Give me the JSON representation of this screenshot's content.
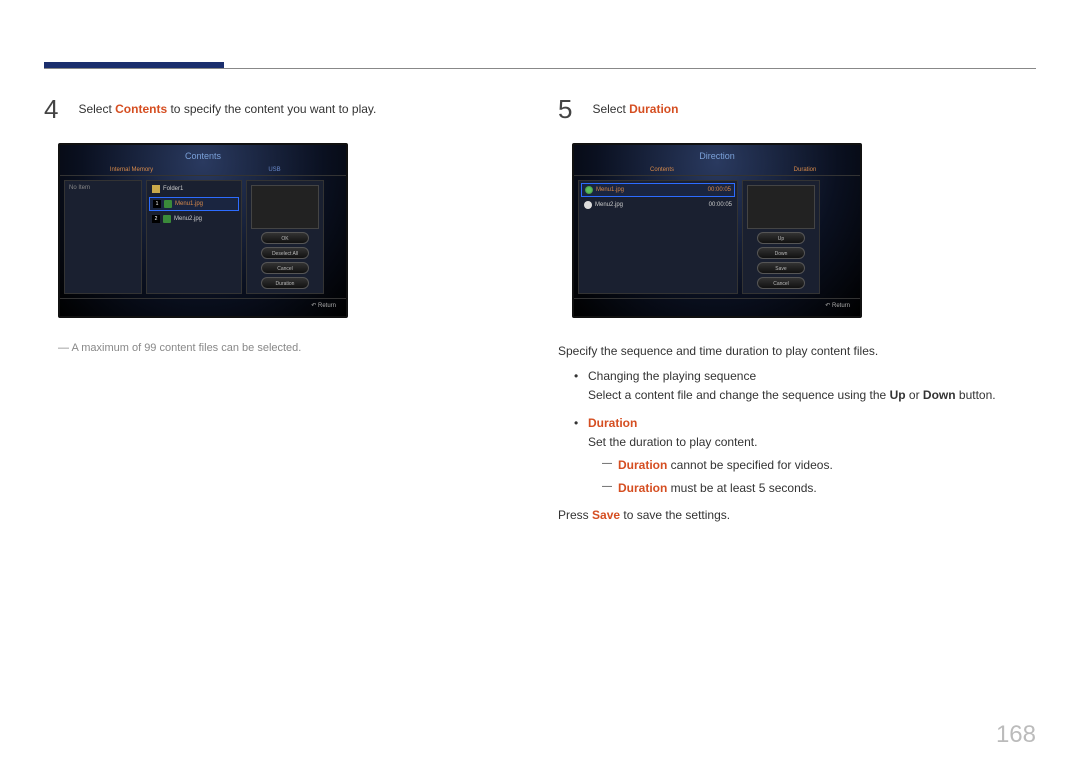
{
  "page_number": "168",
  "step4": {
    "num": "4",
    "text_prefix": "Select ",
    "text_em": "Contents",
    "text_suffix": " to specify the content you want to play.",
    "screenshot": {
      "title": "Contents",
      "tab_a": "Internal Memory",
      "tab_b": "USB",
      "noitem": "No Item",
      "folder": "Folder1",
      "item1_num": "1",
      "item1_name": "Menu1.jpg",
      "item2_num": "2",
      "item2_name": "Menu2.jpg",
      "btn_ok": "OK",
      "btn_deselect": "Deselect All",
      "btn_cancel": "Cancel",
      "btn_duration": "Duration",
      "return": "Return"
    },
    "note_prefix": "―  ",
    "note_text": "A maximum of 99 content files can be selected."
  },
  "step5": {
    "num": "5",
    "text_prefix": "Select ",
    "text_em": "Duration",
    "screenshot": {
      "title": "Direction",
      "tab_a": "Contents",
      "tab_b": "Duration",
      "item1_name": "Menu1.jpg",
      "item1_dur": "00:00:05",
      "item2_name": "Menu2.jpg",
      "item2_dur": "00:00:05",
      "btn_up": "Up",
      "btn_down": "Down",
      "btn_save": "Save",
      "btn_cancel": "Cancel",
      "return": "Return"
    },
    "body": {
      "intro": "Specify the sequence and time duration to play content files.",
      "bullet1_title": "Changing the playing sequence",
      "bullet1_line1a": "Select a content file and change the sequence using the ",
      "bullet1_up": "Up",
      "bullet1_or": " or ",
      "bullet1_down": "Down",
      "bullet1_line1b": " button.",
      "bullet2_em": "Duration",
      "bullet2_desc": "Set the duration to play content.",
      "sub1_em": "Duration",
      "sub1_rest": " cannot be specified for videos.",
      "sub2_em": "Duration",
      "sub2_rest": " must be at least 5 seconds.",
      "press_a": "Press ",
      "press_em": "Save",
      "press_b": " to save the settings."
    }
  }
}
